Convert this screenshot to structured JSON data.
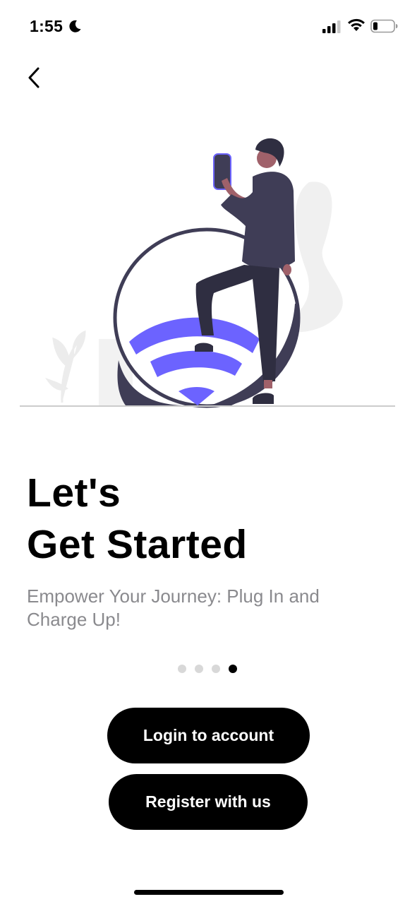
{
  "status_bar": {
    "time": "1:55",
    "icons": [
      "moon-icon",
      "signal-icon",
      "wifi-icon",
      "battery-icon"
    ],
    "battery_level": 0.2
  },
  "navigation": {
    "back_icon": "chevron-left-icon"
  },
  "illustration": {
    "description_icon": "person-charging-wifi-illustration",
    "accent_color": "#6c63ff",
    "figure_color": "#3f3d56"
  },
  "onboarding": {
    "title_line1": "Let's",
    "title_line2": "Get Started",
    "subtitle": "Empower Your Journey: Plug In and Charge Up!",
    "page_count": 4,
    "current_page": 4
  },
  "actions": {
    "login_label": "Login to account",
    "register_label": "Register with us"
  },
  "colors": {
    "primary_button": "#000000",
    "button_text": "#ffffff",
    "subtitle_text": "#8a8a8e",
    "inactive_dot": "#d8d8d8",
    "active_dot": "#000000"
  }
}
